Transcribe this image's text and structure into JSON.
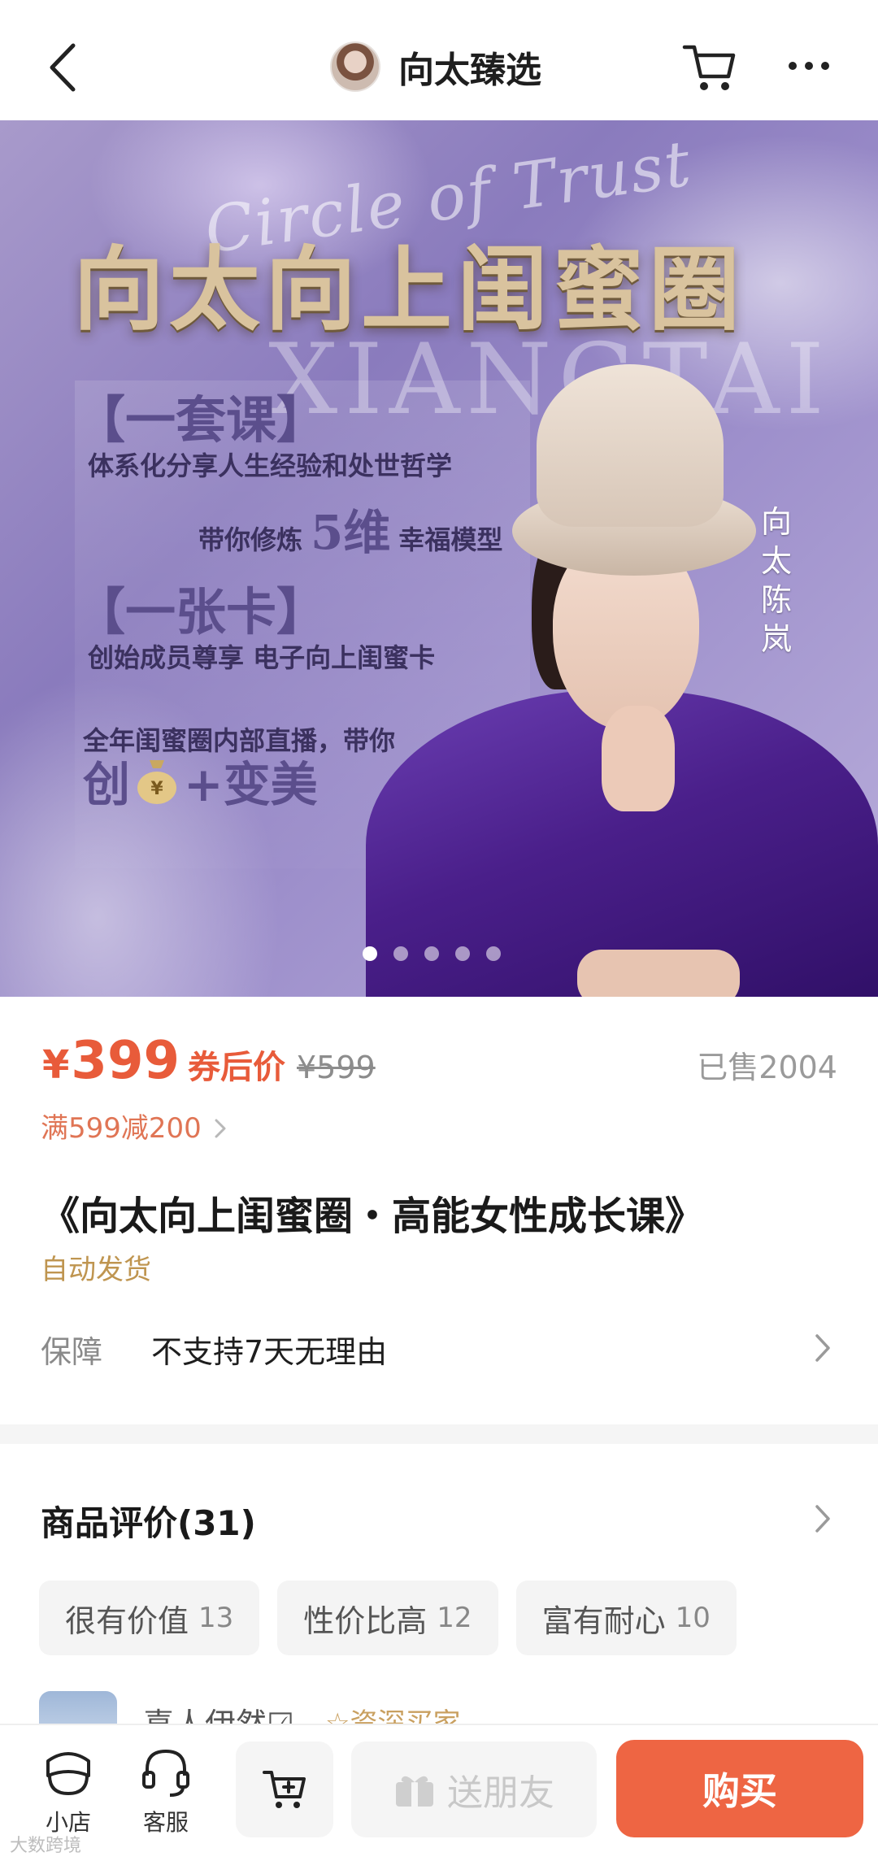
{
  "header": {
    "shop_name": "向太臻选",
    "icons": [
      "back-icon",
      "cart-icon",
      "more-icon"
    ]
  },
  "banner": {
    "script_text": "Circle of Trust",
    "title": "向太向上闺蜜圈",
    "watermark": "XIANGTAI",
    "head1": "【一套课】",
    "line1": "体系化分享人生经验和处世哲学",
    "line2_prefix": "带你修炼",
    "line2_big": "5维",
    "line2_suffix": "幸福模型",
    "head2": "【一张卡】",
    "line3": "创始成员尊享 电子向上闺蜜卡",
    "line4": "全年闺蜜圈内部直播，带你",
    "bottom_left": "创",
    "bottom_right": "+变美",
    "vertical_name": "向太陈岚",
    "slide_count": 5,
    "active_slide": 1
  },
  "price": {
    "currency": "¥",
    "value": "399",
    "after_coupon_label": "券后价",
    "original": "¥599",
    "sold": "已售2004",
    "promo": "满599减200"
  },
  "product": {
    "title": "《向太向上闺蜜圈・高能女性成长课》",
    "delivery": "自动发货"
  },
  "guarantee": {
    "label": "保障",
    "value": "不支持7天无理由"
  },
  "reviews": {
    "title": "商品评价(31)",
    "tags": [
      {
        "label": "很有价值",
        "count": "13"
      },
      {
        "label": "性价比高",
        "count": "12"
      },
      {
        "label": "富有耐心",
        "count": "10"
      }
    ],
    "first_reviewer": {
      "name": "喜人伊然☑",
      "badge": "☆资深买家"
    }
  },
  "bottom_bar": {
    "shop_label": "小店",
    "service_label": "客服",
    "gift_label": "送朋友",
    "buy_label": "购买"
  },
  "footer_watermark": "大数跨境",
  "colors": {
    "accent": "#ee6543",
    "price": "#e85b3a",
    "gold": "#bf9550"
  }
}
